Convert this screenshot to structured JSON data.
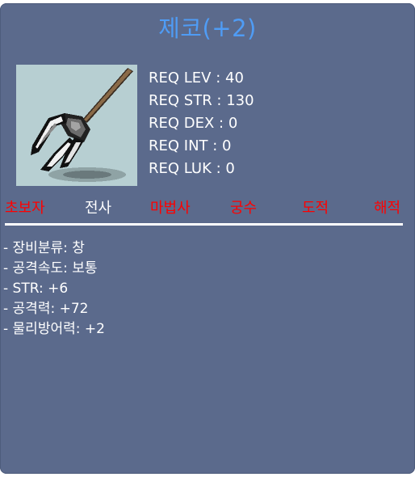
{
  "item": {
    "name": "제코(+2)",
    "icon": "trident-spear-icon",
    "frame_color": "#b7cfd2"
  },
  "requirements": [
    "REQ LEV : 40",
    "REQ STR : 130",
    "REQ DEX : 0",
    "REQ INT : 0",
    "REQ LUK : 0"
  ],
  "jobs": [
    {
      "label": "초보자",
      "usable": false
    },
    {
      "label": "전사",
      "usable": true
    },
    {
      "label": "마법사",
      "usable": false
    },
    {
      "label": "궁수",
      "usable": false
    },
    {
      "label": "도적",
      "usable": false
    },
    {
      "label": "해적",
      "usable": false
    }
  ],
  "stats": [
    "- 장비분류: 창",
    "- 공격속도: 보통",
    "- STR: +6",
    "- 공격력: +72",
    "- 물리방어력: +2"
  ],
  "colors": {
    "panel": "#5b6a8c",
    "title": "#4f9cf5",
    "job_unusable": "#ff0000",
    "job_usable": "#ffffff"
  }
}
